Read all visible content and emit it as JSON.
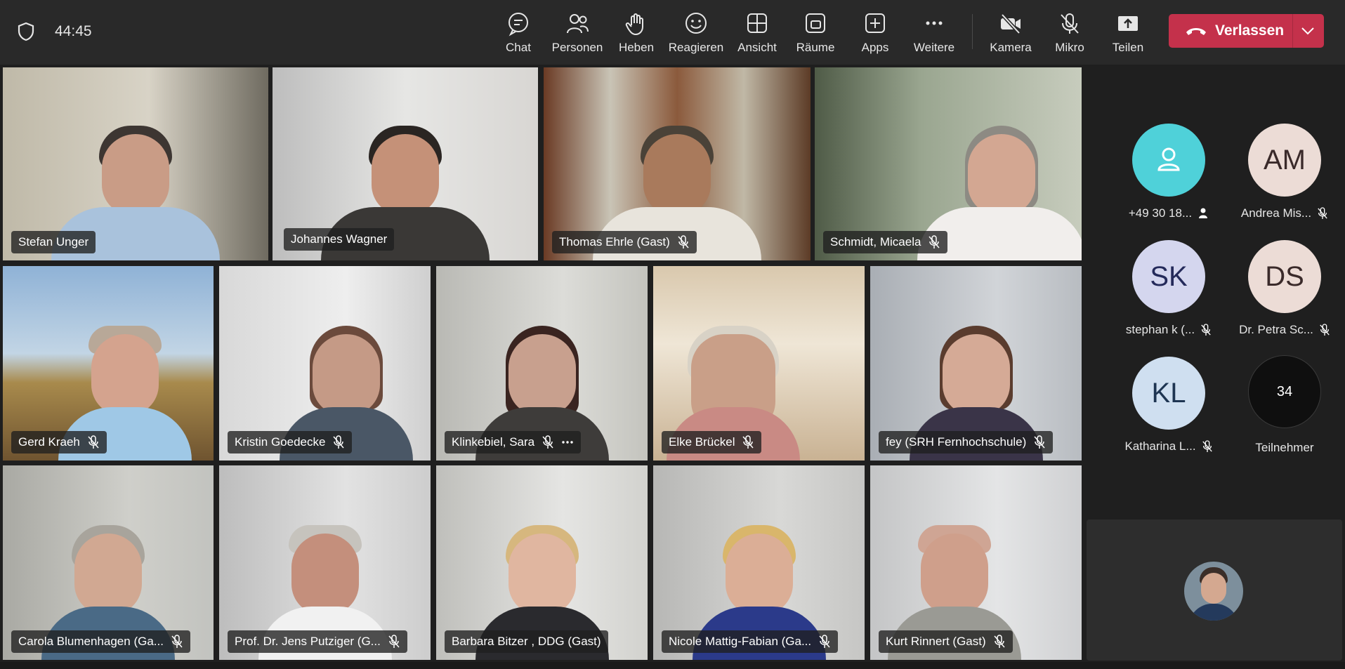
{
  "call": {
    "timer": "44:45"
  },
  "toolbar": {
    "chat": "Chat",
    "people": "Personen",
    "raise": "Heben",
    "react": "Reagieren",
    "view": "Ansicht",
    "rooms": "Räume",
    "apps": "Apps",
    "more": "Weitere",
    "camera": "Kamera",
    "mic": "Mikro",
    "share": "Teilen",
    "leave": "Verlassen"
  },
  "participants": [
    {
      "name": "Stefan Unger",
      "muted": false
    },
    {
      "name": "Johannes Wagner",
      "muted": false,
      "speaking": true
    },
    {
      "name": "Thomas Ehrle (Gast)",
      "muted": true
    },
    {
      "name": "Schmidt, Micaela",
      "muted": true
    },
    {
      "name": "Gerd Kraeh",
      "muted": true
    },
    {
      "name": "Kristin Goedecke",
      "muted": true
    },
    {
      "name": "Klinkebiel, Sara",
      "muted": true
    },
    {
      "name": "Elke Brückel",
      "muted": true
    },
    {
      "name": "fey (SRH Fernhochschule)",
      "muted": true
    },
    {
      "name": "Carola Blumenhagen (Ga...",
      "muted": true
    },
    {
      "name": "Prof. Dr. Jens Putziger (G...",
      "muted": true
    },
    {
      "name": "Barbara Bitzer , DDG (Gast)",
      "muted": false
    },
    {
      "name": "Nicole Mattig-Fabian (Ga...",
      "muted": true
    },
    {
      "name": "Kurt Rinnert (Gast)",
      "muted": true
    }
  ],
  "sidebar": {
    "avatars": [
      {
        "label": "+49 30 18...",
        "initials": "",
        "color": "#4fd1d9"
      },
      {
        "label": "Andrea Mis...",
        "initials": "AM",
        "color": "#ecdcd6"
      },
      {
        "label": "stephan k (...",
        "initials": "SK",
        "color": "#d4d6ee"
      },
      {
        "label": "Dr. Petra Sc...",
        "initials": "DS",
        "color": "#ecdcd6"
      },
      {
        "label": "Katharina L...",
        "initials": "KL",
        "color": "#cfdff0"
      }
    ],
    "overflow": {
      "count": "34",
      "label": "Teilnehmer"
    }
  },
  "colors": {
    "accent": "#7f85f5",
    "leave": "#c4314b"
  }
}
